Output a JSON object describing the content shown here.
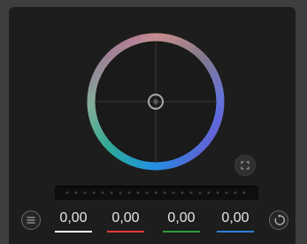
{
  "icons": {
    "menu": "hamburger-icon",
    "expand": "expand-icon",
    "reset": "reset-icon"
  },
  "wheel": {
    "ring_colors": [
      "#e53935",
      "#ff9800",
      "#ffeb3b",
      "#4caf50",
      "#00bcd4",
      "#2196f3",
      "#9c27b0",
      "#e91e63"
    ]
  },
  "values": [
    {
      "label": "0,00",
      "color": "#ffffff"
    },
    {
      "label": "0,00",
      "color": "#e53935"
    },
    {
      "label": "0,00",
      "color": "#2e9d3a"
    },
    {
      "label": "0,00",
      "color": "#2f7fd8"
    }
  ]
}
